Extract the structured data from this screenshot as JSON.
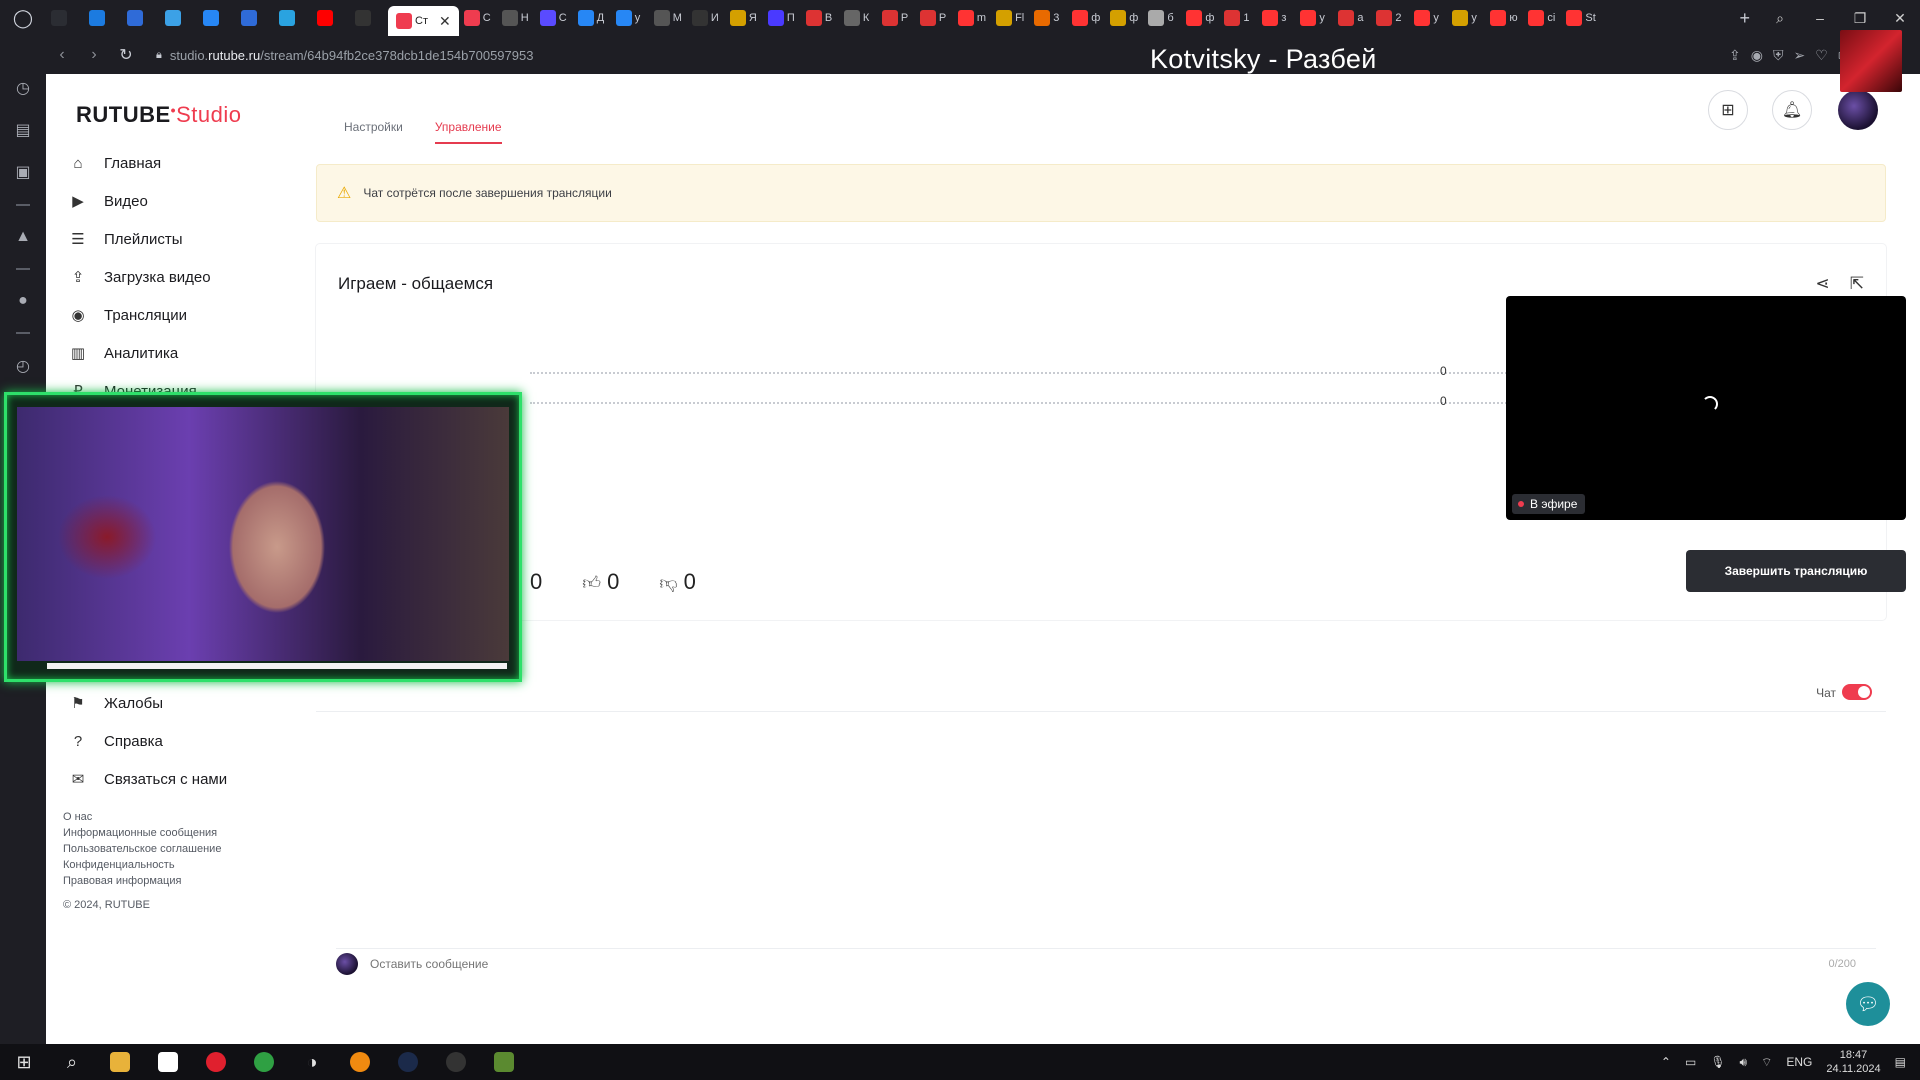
{
  "browser": {
    "tabs": [
      {
        "label": "",
        "icon": "opera-icon",
        "color": "#2b2d33"
      },
      {
        "label": "",
        "icon": "mail-icon",
        "color": "#1c7be0"
      },
      {
        "label": "",
        "icon": "app-icon",
        "color": "#2f6bd8"
      },
      {
        "label": "",
        "icon": "tl-icon",
        "color": "#3ca1e6"
      },
      {
        "label": "",
        "icon": "vk-icon",
        "color": "#2787f5"
      },
      {
        "label": "",
        "icon": "app-icon",
        "color": "#2f6bd8"
      },
      {
        "label": "",
        "icon": "telegram-icon",
        "color": "#2aa3e0"
      },
      {
        "label": "",
        "icon": "youtube-icon",
        "color": "#ff0000"
      },
      {
        "label": "",
        "icon": "r-icon",
        "color": "#333"
      },
      {
        "label": "Ст",
        "icon": "studio-icon",
        "color": "#ef3c4f",
        "active": true
      },
      {
        "label": "С",
        "icon": "studio-icon",
        "color": "#ef3c4f"
      },
      {
        "label": "Н",
        "icon": "m-icon",
        "color": "#555"
      },
      {
        "label": "С",
        "icon": "c-icon",
        "color": "#5a4bff"
      },
      {
        "label": "Д",
        "icon": "vk-icon",
        "color": "#2787f5"
      },
      {
        "label": "у",
        "icon": "vk-icon",
        "color": "#2787f5"
      },
      {
        "label": "М",
        "icon": "diamond-icon",
        "color": "#555"
      },
      {
        "label": "И",
        "icon": "hi-icon",
        "color": "#333"
      },
      {
        "label": "Я",
        "icon": "b-icon",
        "color": "#d4a000"
      },
      {
        "label": "П",
        "icon": "p-icon",
        "color": "#4a3aff"
      },
      {
        "label": "В",
        "icon": "g-icon",
        "color": "#d33"
      },
      {
        "label": "К",
        "icon": "k-icon",
        "color": "#666"
      },
      {
        "label": "Р",
        "icon": "r-icon",
        "color": "#d33"
      },
      {
        "label": "Р",
        "icon": "play-icon",
        "color": "#d33"
      },
      {
        "label": "m",
        "icon": "ya-icon",
        "color": "#f33"
      },
      {
        "label": "Fl",
        "icon": "hi-icon",
        "color": "#d4a000"
      },
      {
        "label": "3",
        "icon": "x-icon",
        "color": "#e86a00"
      },
      {
        "label": "ф",
        "icon": "ya-icon",
        "color": "#f33"
      },
      {
        "label": "ф",
        "icon": "flag-icon",
        "color": "#d4a000"
      },
      {
        "label": "б",
        "icon": "arch-icon",
        "color": "#aaa"
      },
      {
        "label": "ф",
        "icon": "ya-icon",
        "color": "#f33"
      },
      {
        "label": "1",
        "icon": "percent-icon",
        "color": "#d33"
      },
      {
        "label": "з",
        "icon": "ya-icon",
        "color": "#f33"
      },
      {
        "label": "у",
        "icon": "ya-icon",
        "color": "#f33"
      },
      {
        "label": "а",
        "icon": "x-icon",
        "color": "#d33"
      },
      {
        "label": "2",
        "icon": "x-icon",
        "color": "#d33"
      },
      {
        "label": "у",
        "icon": "ya-icon",
        "color": "#f33"
      },
      {
        "label": "у",
        "icon": "flag-icon",
        "color": "#d4a000"
      },
      {
        "label": "ю",
        "icon": "ya-icon",
        "color": "#f33"
      },
      {
        "label": "сі",
        "icon": "ya-icon",
        "color": "#f33"
      },
      {
        "label": "St",
        "icon": "ya-icon",
        "color": "#f33"
      }
    ],
    "url_prefix": "studio.",
    "url_domain": "rutube.ru",
    "url_path": "/stream/64b94fb2ce378dcb1de154b700597953"
  },
  "overlay": {
    "now_playing": "Kotvitsky - Разбей"
  },
  "header": {
    "logo_main": "RUTUBE",
    "logo_studio": "Studio"
  },
  "sidebar": {
    "items": [
      {
        "label": "Главная",
        "icon": "home-icon"
      },
      {
        "label": "Видео",
        "icon": "video-icon"
      },
      {
        "label": "Плейлисты",
        "icon": "list-icon"
      },
      {
        "label": "Загрузка видео",
        "icon": "upload-icon"
      },
      {
        "label": "Трансляции",
        "icon": "broadcast-icon"
      },
      {
        "label": "Аналитика",
        "icon": "analytics-icon"
      },
      {
        "label": "Монетизация",
        "icon": "ruble-icon"
      }
    ],
    "lower_items": [
      {
        "label": "Жалобы",
        "icon": "flag-icon"
      },
      {
        "label": "Справка",
        "icon": "help-icon"
      },
      {
        "label": "Связаться с нами",
        "icon": "mail-icon"
      }
    ],
    "footer_links": [
      "О нас",
      "Информационные сообщения",
      "Пользовательское соглашение",
      "Конфиденциальность",
      "Правовая информация"
    ],
    "copyright": "© 2024, RUTUBE"
  },
  "content": {
    "tabs": [
      {
        "label": "Настройки",
        "active": false
      },
      {
        "label": "Управление",
        "active": true
      }
    ],
    "warning": "Чат сотрётся после завершения трансляции",
    "stream": {
      "title": "Играем - общаемся",
      "metric_1": "0",
      "metric_2": "0",
      "views": "0",
      "likes": "0",
      "dislikes": "0",
      "live_badge": "В эфире",
      "end_button": "Завершить трансляцию"
    },
    "chat": {
      "label": "Чат",
      "enabled": true,
      "placeholder": "Оставить сообщение",
      "counter": "0/200"
    }
  },
  "taskbar": {
    "lang": "ENG",
    "time": "18:47",
    "date": "24.11.2024"
  },
  "colors": {
    "accent": "#ef3c4f",
    "warning_bg": "#fdf7e6",
    "dark_button": "#2b2d33",
    "webcam_frame": "#2ee06a"
  }
}
